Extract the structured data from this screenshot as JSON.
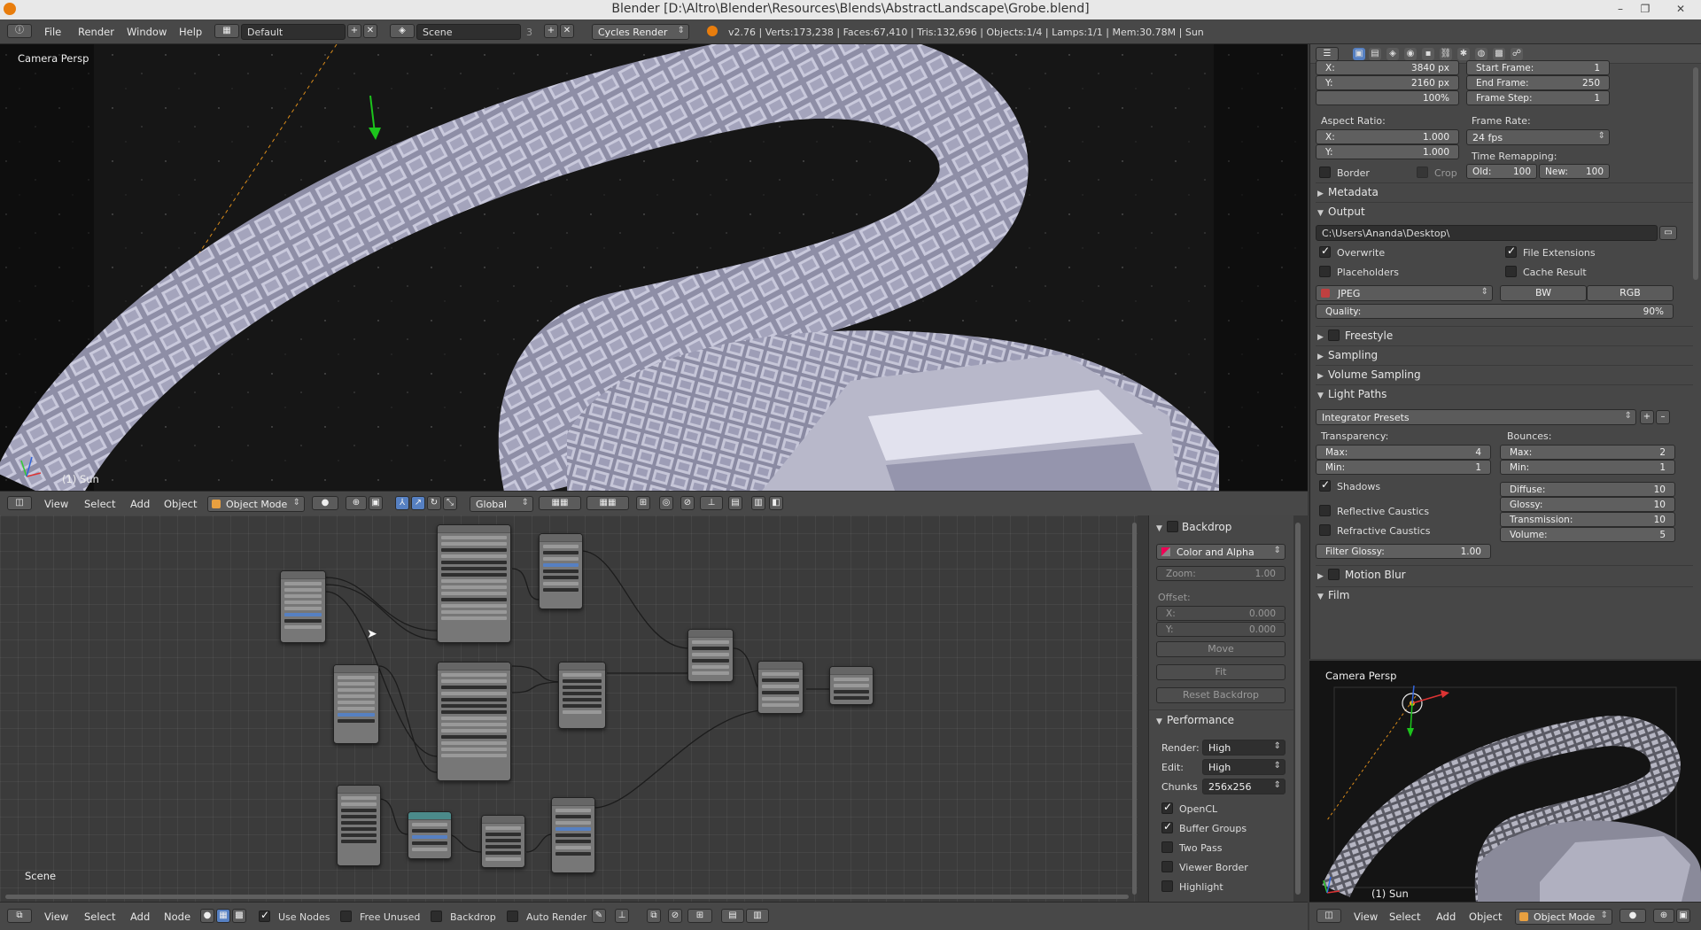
{
  "window": {
    "title": "Blender  [D:\\Altro\\Blender\\Resources\\Blends\\AbstractLandscape\\Grobe.blend]"
  },
  "info": {
    "menus": [
      "File",
      "Render",
      "Window",
      "Help"
    ],
    "screen_layout": "Default",
    "scene": "Scene",
    "scene_users": "3",
    "engine": "Cycles Render",
    "stats": "v2.76 | Verts:173,238 | Faces:67,410 | Tris:132,696 | Objects:1/4 | Lamps:1/1 | Mem:30.78M | Sun"
  },
  "viewport": {
    "label": "Camera Persp",
    "object_label": "(1) Sun"
  },
  "view3d_header": {
    "menus": [
      "View",
      "Select",
      "Add",
      "Object"
    ],
    "mode": "Object Mode",
    "orientation": "Global"
  },
  "node_editor": {
    "label": "Scene"
  },
  "npanel": {
    "backdrop": {
      "title": "Backdrop",
      "channels": "Color and Alpha",
      "zoom_label": "Zoom:",
      "zoom": "1.00",
      "offset_label": "Offset:",
      "x_label": "X:",
      "x": "0.000",
      "y_label": "Y:",
      "y": "0.000",
      "move": "Move",
      "fit": "Fit",
      "reset": "Reset Backdrop"
    },
    "performance": {
      "title": "Performance",
      "render_label": "Render:",
      "render": "High",
      "edit_label": "Edit:",
      "edit": "High",
      "chunks_label": "Chunks",
      "chunks": "256x256",
      "opencl": "OpenCL",
      "buffer_groups": "Buffer Groups",
      "two_pass": "Two Pass",
      "viewer_border": "Viewer Border",
      "highlight": "Highlight"
    }
  },
  "node_header": {
    "menus": [
      "View",
      "Select",
      "Add",
      "Node"
    ],
    "use_nodes": "Use Nodes",
    "free_unused": "Free Unused",
    "backdrop": "Backdrop",
    "auto_render": "Auto Render"
  },
  "props": {
    "res_x_label": "X:",
    "res_x": "3840 px",
    "res_y_label": "Y:",
    "res_y": "2160 px",
    "res_pct": "100%",
    "start_label": "Start Frame:",
    "start": "1",
    "end_label": "End Frame:",
    "end": "250",
    "step_label": "Frame Step:",
    "step": "1",
    "aspect_label": "Aspect Ratio:",
    "aspect_x_label": "X:",
    "aspect_x": "1.000",
    "aspect_y_label": "Y:",
    "aspect_y": "1.000",
    "framerate_label": "Frame Rate:",
    "framerate": "24 fps",
    "remap_label": "Time Remapping:",
    "old_label": "Old:",
    "old": "100",
    "new_label": "New:",
    "new": "100",
    "border": "Border",
    "crop": "Crop",
    "metadata": "Metadata",
    "output": "Output",
    "output_path": "C:\\Users\\Ananda\\Desktop\\",
    "overwrite": "Overwrite",
    "file_extensions": "File Extensions",
    "placeholders": "Placeholders",
    "cache_result": "Cache Result",
    "format": "JPEG",
    "bw": "BW",
    "rgb": "RGB",
    "quality_label": "Quality:",
    "quality": "90%",
    "freestyle": "Freestyle",
    "sampling": "Sampling",
    "volume_sampling": "Volume Sampling",
    "light_paths": "Light Paths",
    "integrator_presets": "Integrator Presets",
    "transparency_label": "Transparency:",
    "bounces_label": "Bounces:",
    "t_max_label": "Max:",
    "t_max": "4",
    "t_min_label": "Min:",
    "t_min": "1",
    "b_max_label": "Max:",
    "b_max": "2",
    "b_min_label": "Min:",
    "b_min": "1",
    "shadows": "Shadows",
    "diffuse_label": "Diffuse:",
    "diffuse": "10",
    "glossy_label": "Glossy:",
    "glossy": "10",
    "transmission_label": "Transmission:",
    "transmission": "10",
    "volume_label": "Volume:",
    "volume": "5",
    "reflective": "Reflective Caustics",
    "refractive": "Refractive Caustics",
    "filter_label": "Filter Glossy:",
    "filter": "1.00",
    "motion_blur": "Motion Blur",
    "film": "Film"
  },
  "camview": {
    "label": "Camera Persp",
    "object_label": "(1) Sun"
  },
  "cam_header": {
    "menus": [
      "View",
      "Select",
      "Add",
      "Object"
    ],
    "mode": "Object Mode"
  }
}
